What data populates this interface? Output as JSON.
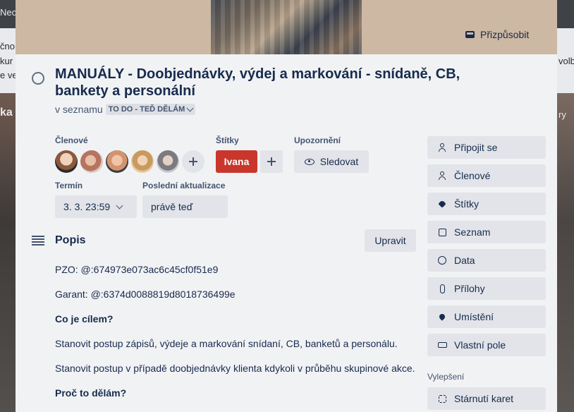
{
  "background": {
    "fragments": [
      "Neo",
      "čno",
      "kur",
      "e ve",
      "ka",
      "volb",
      "ry"
    ]
  },
  "card": {
    "cover_button": "Přizpůsobit",
    "title": "MANUÁLY - Doobjednávky, výdej a markování - snídaně, CB, bankety a personální",
    "in_list_prefix": "v seznamu",
    "list_name": "TO DO - TEĎ DĚLÁM"
  },
  "members": {
    "heading": "Členové",
    "avatars": [
      "avatar-1",
      "avatar-2",
      "avatar-3",
      "avatar-4",
      "avatar-5"
    ]
  },
  "labels": {
    "heading": "Štítky",
    "items": [
      {
        "text": "Ivana",
        "color": "#c9372c"
      }
    ]
  },
  "notifications": {
    "heading": "Upozornění",
    "watch_label": "Sledovat"
  },
  "due": {
    "heading": "Termín",
    "value": "3. 3. 23:59"
  },
  "last_update": {
    "heading": "Poslední aktualizace",
    "value": "právě teď"
  },
  "description": {
    "heading": "Popis",
    "edit_label": "Upravit",
    "lines": [
      "PZO: @:674973e073ac6c45cf0f51e9",
      "Garant: @:6374d0088819d8018736499e",
      "Co je cílem?",
      "Stanovit postup zápisů, výdeje a markování snídaní, CB, banketů a personálu.",
      "Stanovit postup v případě doobjednávky klienta kdykoli v průběhu skupinové akce.",
      "Proč to dělám?"
    ]
  },
  "sidebar": {
    "actions": [
      {
        "label": "Připojit se",
        "icon": "add-person-icon"
      },
      {
        "label": "Členové",
        "icon": "person-icon"
      },
      {
        "label": "Štítky",
        "icon": "tag-icon"
      },
      {
        "label": "Seznam",
        "icon": "checklist-icon"
      },
      {
        "label": "Data",
        "icon": "clock-icon"
      },
      {
        "label": "Přílohy",
        "icon": "paperclip-icon"
      },
      {
        "label": "Umístění",
        "icon": "location-pin-icon"
      },
      {
        "label": "Vlastní pole",
        "icon": "custom-field-icon"
      }
    ],
    "powerups_heading": "Vylepšení",
    "powerups": [
      {
        "label": "Stárnutí karet",
        "icon": "card-aging-icon"
      }
    ]
  }
}
